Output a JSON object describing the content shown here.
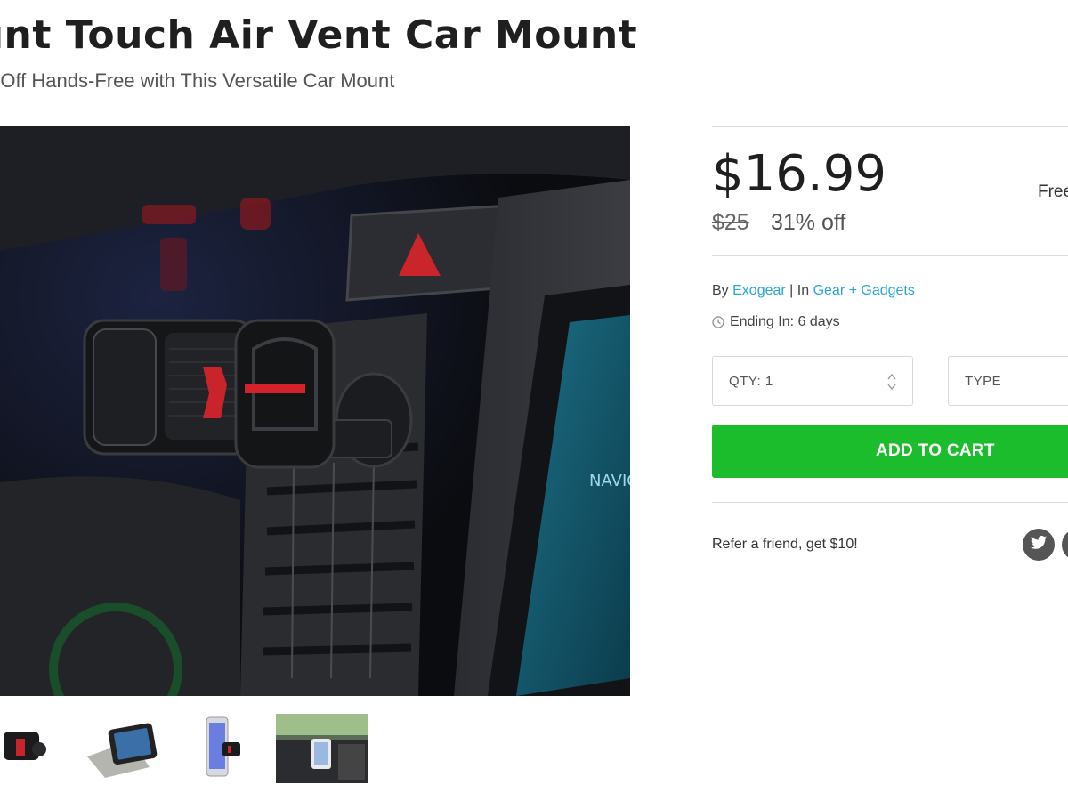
{
  "product": {
    "title": "ount Touch Air Vent Car Mount",
    "subtitle": "e Off Hands-Free with This Versatile Car Mount"
  },
  "pricing": {
    "price": "$16.99",
    "shipping": "Free",
    "original_price": "$25",
    "discount": "31% off"
  },
  "meta": {
    "by_label": "By",
    "vendor": "Exogear",
    "separator": "|",
    "in_label": "In",
    "category": "Gear + Gadgets",
    "ending": "Ending In: 6 days"
  },
  "options": {
    "qty_label": "QTY: 1",
    "type_label": "TYPE"
  },
  "cart": {
    "add_label": "ADD TO CART"
  },
  "social": {
    "refer_text": "Refer a friend, get $10!"
  },
  "colors": {
    "accent_green": "#1cbd2d",
    "link_blue": "#2aa5d8",
    "dark_gray": "#555555"
  },
  "icons": [
    "clock-icon",
    "stepper-icon",
    "twitter-icon",
    "share-icon"
  ]
}
